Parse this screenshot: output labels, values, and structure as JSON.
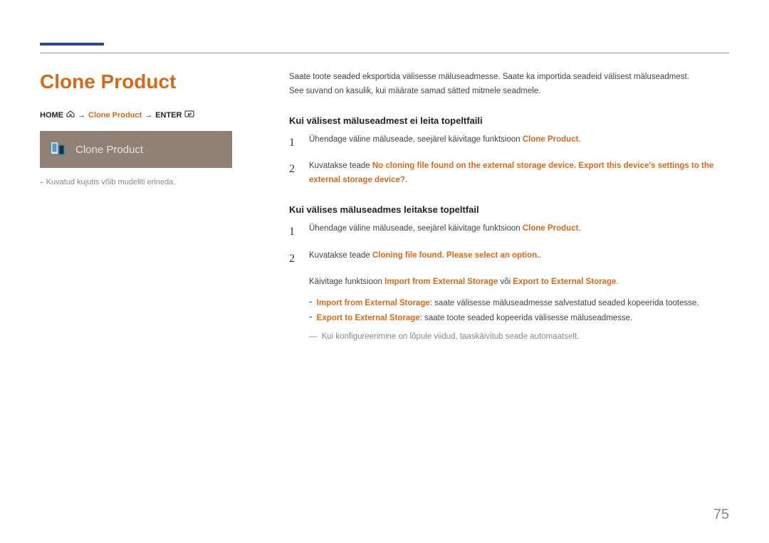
{
  "title": "Clone Product",
  "breadcrumb": {
    "home": "HOME",
    "arrow1": "→",
    "item": "Clone Product",
    "arrow2": "→",
    "enter": "ENTER"
  },
  "panel": {
    "label": "Clone Product"
  },
  "leftNote": "Kuvatud kujutis võib mudeliti erineda.",
  "intro1": "Saate toote seaded eksportida välisesse mäluseadmesse. Saate ka importida seadeid välisest mäluseadmest.",
  "intro2": "See suvand on kasulik, kui määrate samad sätted mitmele seadmele.",
  "section1": {
    "heading": "Kui välisest mäluseadmest ei leita topeltfaili",
    "step1_pre": "Ühendage väline mäluseade, seejärel käivitage funktsioon ",
    "step1_hl": "Clone Product",
    "step1_post": ".",
    "step2_pre": "Kuvatakse teade ",
    "step2_hl": "No cloning file found on the external storage device. Export this device's settings to the external storage device?",
    "step2_post": "."
  },
  "section2": {
    "heading": "Kui välises mäluseadmes leitakse topeltfail",
    "step1_pre": "Ühendage väline mäluseade, seejärel käivitage funktsioon ",
    "step1_hl": "Clone Product",
    "step1_post": ".",
    "step2_pre": "Kuvatakse teade ",
    "step2_hl": "Cloning file found. Please select an option.",
    "step2_post": ".",
    "sub_pre": "Käivitage funktsioon ",
    "sub_hl1": "Import from External Storage",
    "sub_mid": " või ",
    "sub_hl2": "Export to External Storage",
    "sub_post": ".",
    "b1_hl": "Import from External Storage",
    "b1_txt": ": saate välisesse mäluseadmesse salvestatud seaded kopeerida tootesse.",
    "b2_hl": "Export to External Storage",
    "b2_txt": ": saate toote seaded kopeerida välisesse mäluseadmesse.",
    "final": "Kui konfigureerimine on lõpule viidud, taaskäivitub seade automaatselt."
  },
  "nums": {
    "n1": "1",
    "n2": "2"
  },
  "dash": "―",
  "sdash": "-",
  "pageNumber": "75"
}
